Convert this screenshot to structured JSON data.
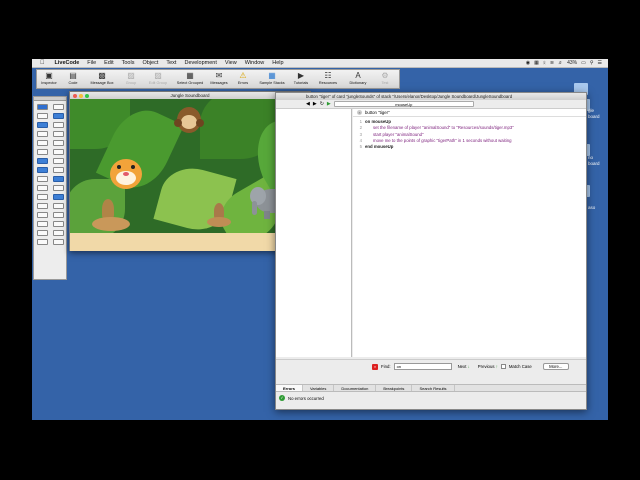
{
  "menubar": {
    "apple": "",
    "app_name": "LiveCode",
    "items": [
      "File",
      "Edit",
      "Tools",
      "Object",
      "Text",
      "Development",
      "View",
      "Window",
      "Help"
    ],
    "status": {
      "battery": "43%"
    }
  },
  "toolbar": {
    "buttons": [
      {
        "label": "Inspector",
        "icon": "inspector-icon",
        "enabled": true
      },
      {
        "label": "Code",
        "icon": "code-icon",
        "enabled": true
      },
      {
        "label": "Message Box",
        "icon": "message-box-icon",
        "enabled": true
      },
      {
        "label": "Group",
        "icon": "group-icon",
        "enabled": false
      },
      {
        "label": "Edit Group",
        "icon": "edit-group-icon",
        "enabled": false
      },
      {
        "label": "Select Grouped",
        "icon": "select-grouped-icon",
        "enabled": true
      },
      {
        "label": "Messages",
        "icon": "messages-icon",
        "enabled": true
      },
      {
        "label": "Errors",
        "icon": "warning-icon",
        "enabled": true
      },
      {
        "label": "Sample Stacks",
        "icon": "sample-stacks-icon",
        "enabled": true
      },
      {
        "label": "Tutorials",
        "icon": "tutorials-icon",
        "enabled": true
      },
      {
        "label": "Resources",
        "icon": "resources-icon",
        "enabled": true
      },
      {
        "label": "Dictionary",
        "icon": "dictionary-icon",
        "enabled": true
      },
      {
        "label": "Test",
        "icon": "test-icon",
        "enabled": false
      }
    ]
  },
  "desktop": {
    "labels": [
      "gle",
      "board",
      "no",
      "board",
      "aso"
    ]
  },
  "stack_window": {
    "title": "Jungle Soundboard"
  },
  "script_editor": {
    "title": "button \"tiger\" of card \"jungleSounds\" of stack \"/Users/elanor/Desktop/Jungle Soundboard/JungleSoundboard",
    "handler": "mouseUp",
    "tab": "button \"tiger\"",
    "code_lines": [
      {
        "n": "1",
        "text": "on mouseUp",
        "kw": true
      },
      {
        "n": "2",
        "text": "set the filename of player \"animalSound\" to \"Resources/sounds/tiger.mp3\"",
        "kw": false
      },
      {
        "n": "3",
        "text": "start player \"animalSound\"",
        "kw": false
      },
      {
        "n": "4",
        "text": "move me to the points of graphic \"tigerPath\" in 1 seconds without waiting",
        "kw": false
      },
      {
        "n": "5",
        "text": "end mouseUp",
        "kw": true
      }
    ],
    "find": {
      "label": "Find:",
      "value": "on",
      "next": "Next",
      "previous": "Previous",
      "match_case": "Match Case",
      "more": "More..."
    },
    "bottom_tabs": [
      "Errors",
      "Variables",
      "Documentation",
      "Breakpoints",
      "Search Results"
    ],
    "status": "No errors occurred"
  }
}
